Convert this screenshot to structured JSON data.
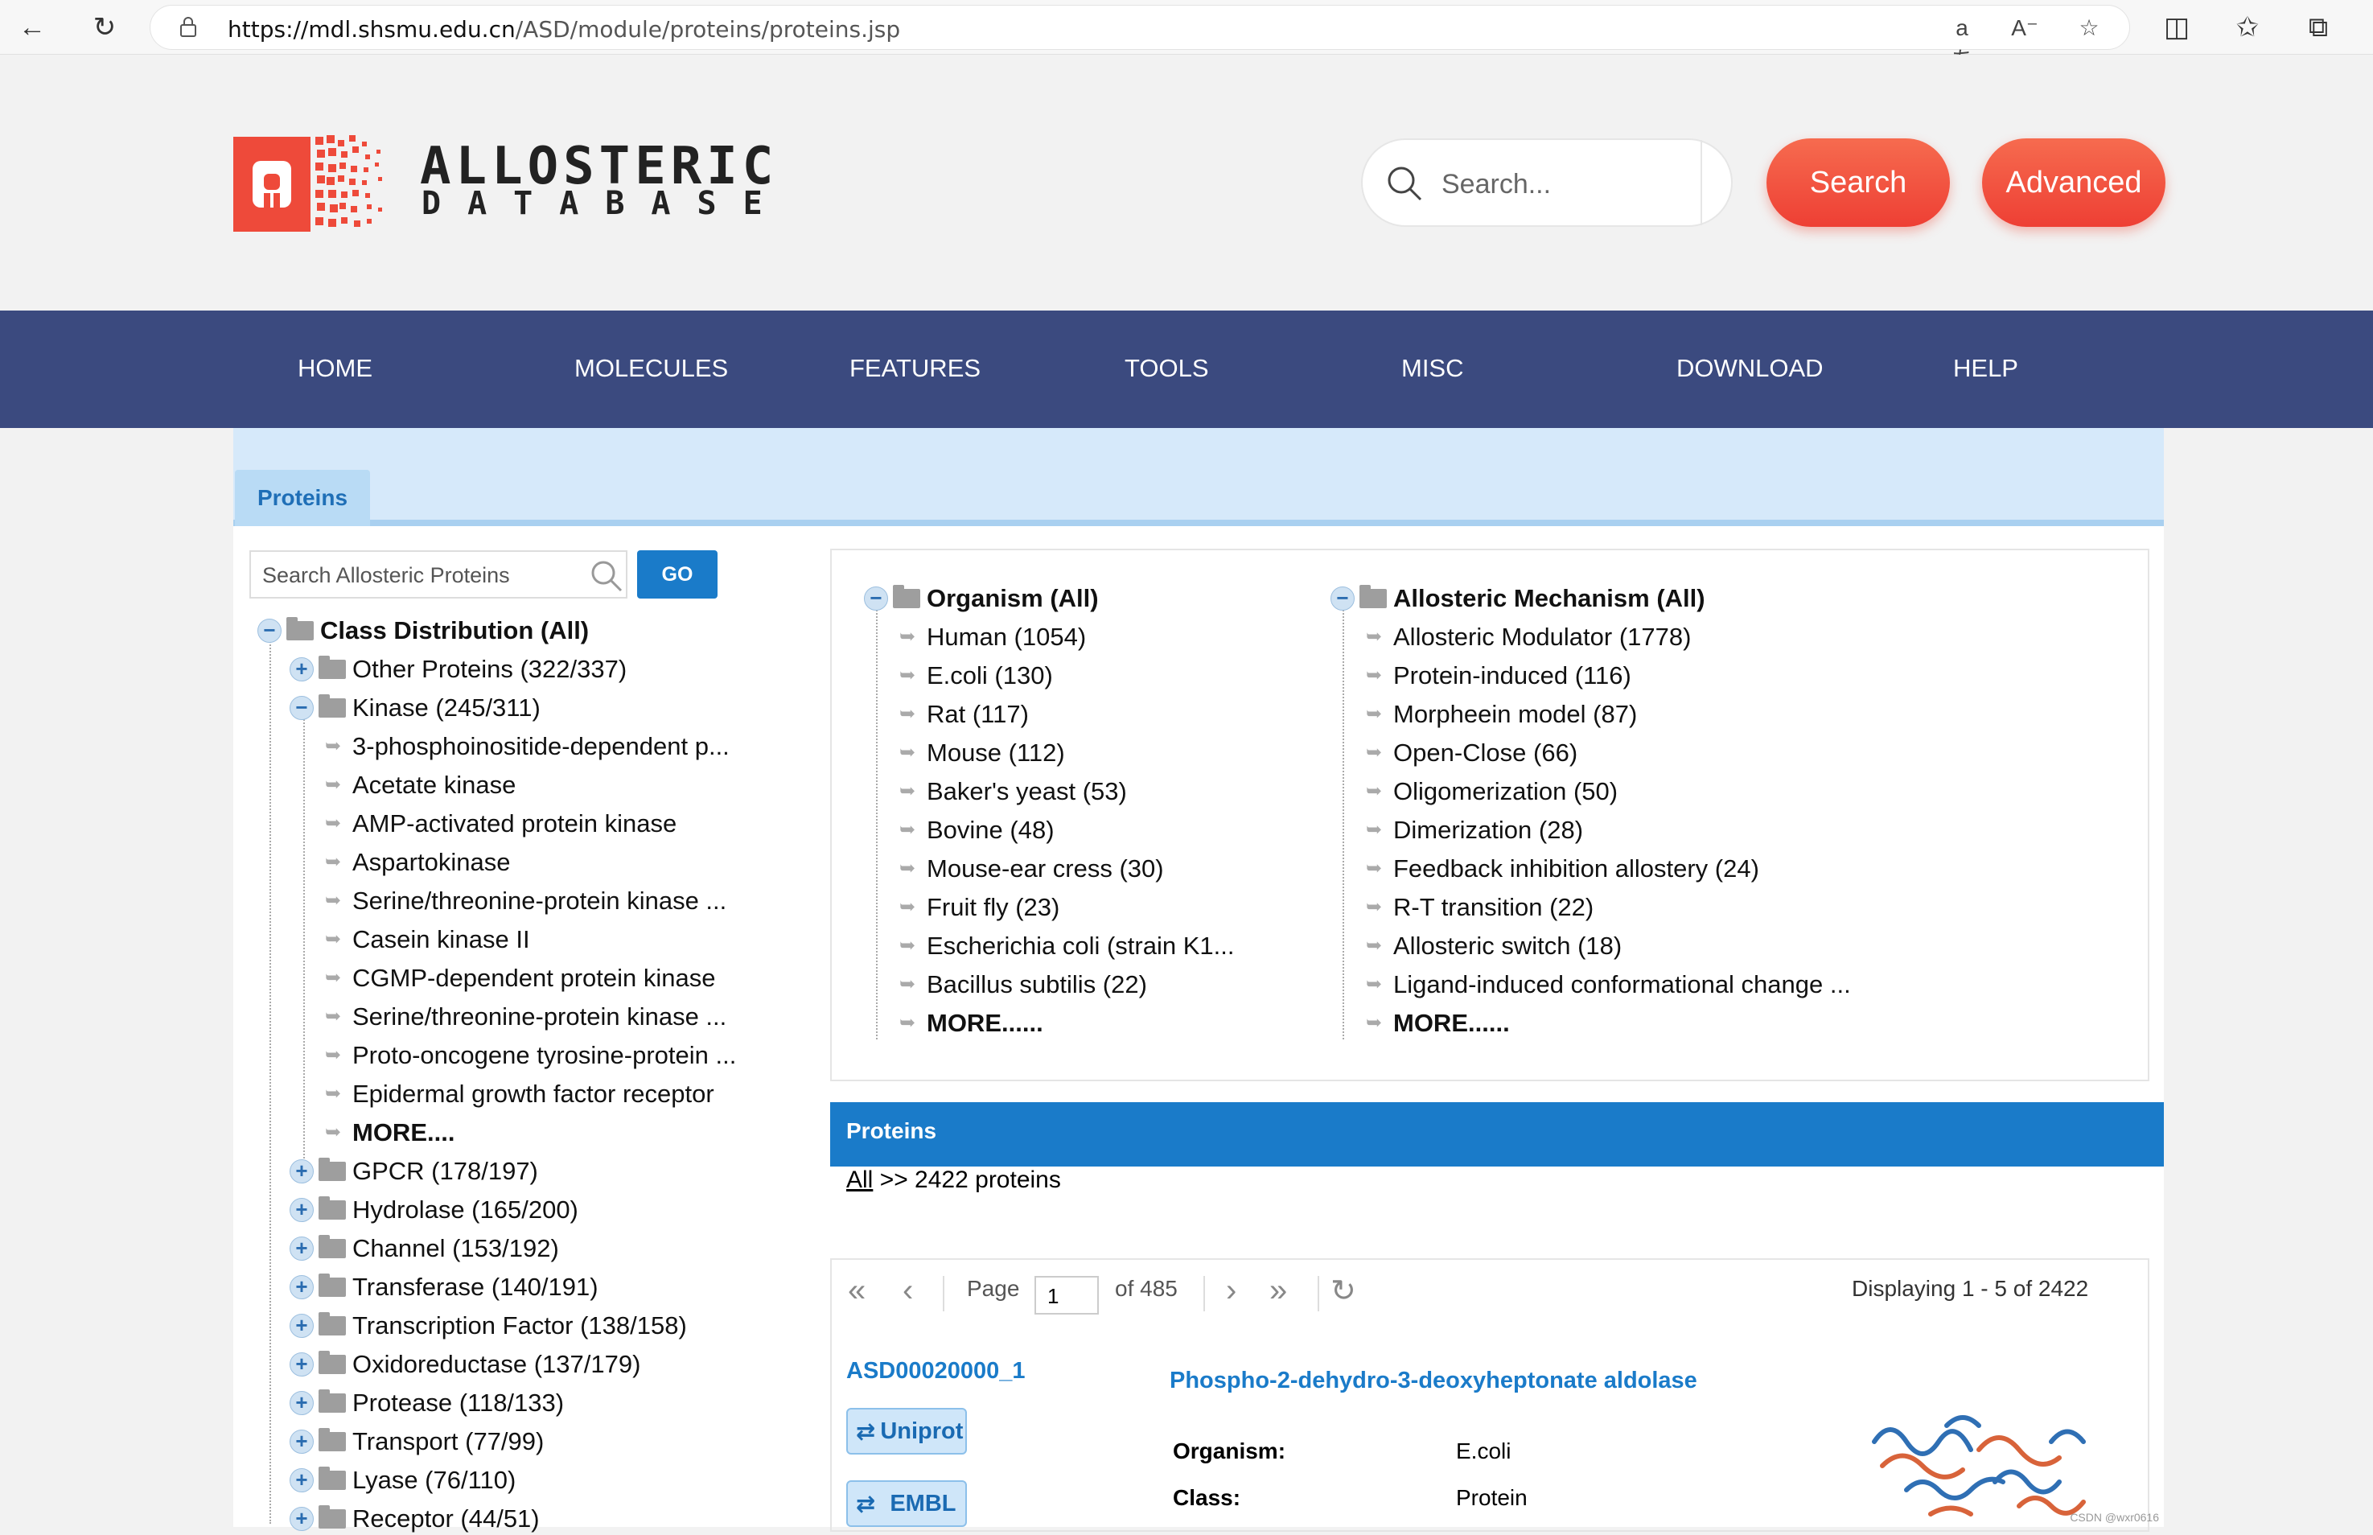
{
  "browser": {
    "url_host": "https://mdl.shsmu.edu.cn",
    "url_path": "/ASD/module/proteins/proteins.jsp"
  },
  "header": {
    "logo_line1": "ALLOSTERIC",
    "logo_line2": "DATABASE",
    "search_placeholder": "Search...",
    "search_button": "Search",
    "advanced_button": "Advanced"
  },
  "nav": {
    "items": [
      "HOME",
      "MOLECULES",
      "FEATURES",
      "TOOLS",
      "MISC",
      "DOWNLOAD",
      "HELP"
    ]
  },
  "tab": {
    "label": "Proteins"
  },
  "left": {
    "search_placeholder": "Search Allosteric Proteins",
    "go_label": "GO",
    "root": "Class Distribution (All)",
    "groups": [
      {
        "label": "Other Proteins (322/337)",
        "expanded": false
      },
      {
        "label": "Kinase (245/311)",
        "expanded": true
      },
      {
        "label": "GPCR (178/197)",
        "expanded": false
      },
      {
        "label": "Hydrolase (165/200)",
        "expanded": false
      },
      {
        "label": "Channel (153/192)",
        "expanded": false
      },
      {
        "label": "Transferase (140/191)",
        "expanded": false
      },
      {
        "label": "Transcription Factor (138/158)",
        "expanded": false
      },
      {
        "label": "Oxidoreductase (137/179)",
        "expanded": false
      },
      {
        "label": "Protease (118/133)",
        "expanded": false
      },
      {
        "label": "Transport (77/99)",
        "expanded": false
      },
      {
        "label": "Lyase (76/110)",
        "expanded": false
      },
      {
        "label": "Receptor (44/51)",
        "expanded": false
      }
    ],
    "kinase_children": [
      "3-phosphoinositide-dependent p...",
      "Acetate kinase",
      "AMP-activated protein kinase",
      "Aspartokinase",
      "Serine/threonine-protein kinase ...",
      "Casein kinase II",
      "CGMP-dependent protein kinase",
      "Serine/threonine-protein kinase ...",
      "Proto-oncogene tyrosine-protein ...",
      "Epidermal growth factor receptor",
      "MORE...."
    ]
  },
  "organism": {
    "root": "Organism (All)",
    "items": [
      "Human (1054)",
      "E.coli (130)",
      "Rat (117)",
      "Mouse (112)",
      "Baker's yeast (53)",
      "Bovine (48)",
      "Mouse-ear cress (30)",
      "Fruit fly (23)",
      "Escherichia coli (strain K1...",
      "Bacillus subtilis (22)",
      "MORE......"
    ]
  },
  "mechanism": {
    "root": "Allosteric Mechanism (All)",
    "items": [
      "Allosteric Modulator (1778)",
      "Protein-induced (116)",
      "Morpheein model (87)",
      "Open-Close (66)",
      "Oligomerization (50)",
      "Dimerization (28)",
      "Feedback inhibition allostery (24)",
      "R-T transition (22)",
      "Allosteric switch (18)",
      "Ligand-induced conformational change ...",
      "MORE......"
    ]
  },
  "results": {
    "bar_title": "Proteins",
    "breadcrumb_link": "All",
    "breadcrumb_rest": ">> 2422 proteins",
    "page_label": "Page",
    "page_value": "1",
    "of_pages": "of 485",
    "displaying": "Displaying 1 - 5 of 2422",
    "first": {
      "id": "ASD00020000_1",
      "name": "Phospho-2-dehydro-3-deoxyheptonate aldolase",
      "uniprot": "Uniprot",
      "embl": "EMBL",
      "organism_label": "Organism",
      "organism_value": "E.coli",
      "class_label": "Class:",
      "class_value": "Protein"
    }
  },
  "watermark": "CSDN @wxr0616"
}
